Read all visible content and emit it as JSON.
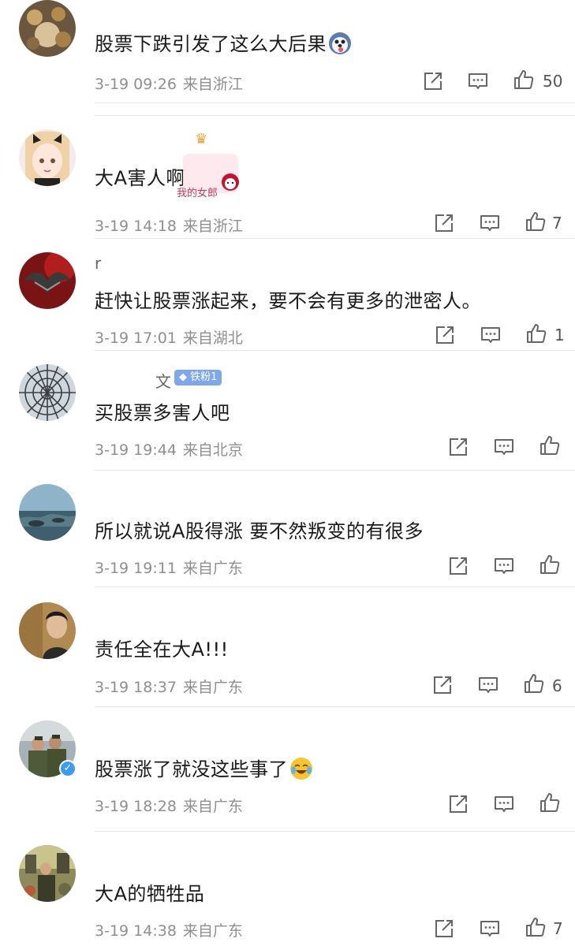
{
  "comments": [
    {
      "text": "股票下跌引发了这么大后果",
      "emoji": "dog-emoji",
      "date": "3-19 09:26",
      "location": "来自浙江",
      "likes": "50"
    },
    {
      "text": "大A害人啊",
      "date": "3-19 14:18",
      "location": "来自浙江",
      "likes": "7",
      "sticker_label": "我的女郎"
    },
    {
      "text": "赶快让股票涨起来，要不会有更多的泄密人。",
      "date": "3-19 17:01",
      "location": "来自湖北",
      "likes": "1",
      "username": "r"
    },
    {
      "text": "买股票多害人吧",
      "date": "3-19 19:44",
      "location": "来自北京",
      "likes": "",
      "username": "文",
      "badge": "铁粉1"
    },
    {
      "text": "所以就说A股得涨 要不然叛变的有很多",
      "date": "3-19 19:11",
      "location": "来自广东",
      "likes": ""
    },
    {
      "text": "责任全在大A!!!",
      "date": "3-19 18:37",
      "location": "来自广东",
      "likes": "6"
    },
    {
      "text": "股票涨了就没这些事了",
      "emoji": "crying-laughing-emoji",
      "date": "3-19 18:28",
      "location": "来自广东",
      "likes": ""
    },
    {
      "text": "大A的牺牲品",
      "date": "3-19 14:38",
      "location": "来自广东",
      "likes": "7"
    }
  ]
}
